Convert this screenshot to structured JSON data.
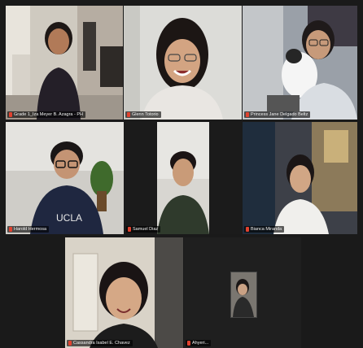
{
  "meeting": {
    "participants": [
      {
        "name": "Grade 1_Iza Meyer B. Azagra - PH"
      },
      {
        "name": "Glenn Totorio"
      },
      {
        "name": "Princess Jane Delgado Beltz"
      },
      {
        "name": "Harold Hermosa"
      },
      {
        "name": "Samuel Diaz"
      },
      {
        "name": "Bianca Miranda"
      },
      {
        "name": "Cassandra Isabel E. Chavez"
      },
      {
        "name": "Ahyeri..."
      }
    ],
    "mic_icon": "muted-mic-icon",
    "colors": {
      "active_speaker_border": "#c9e24a",
      "background": "#1a1a1a",
      "muted_icon": "#e0422f"
    }
  }
}
